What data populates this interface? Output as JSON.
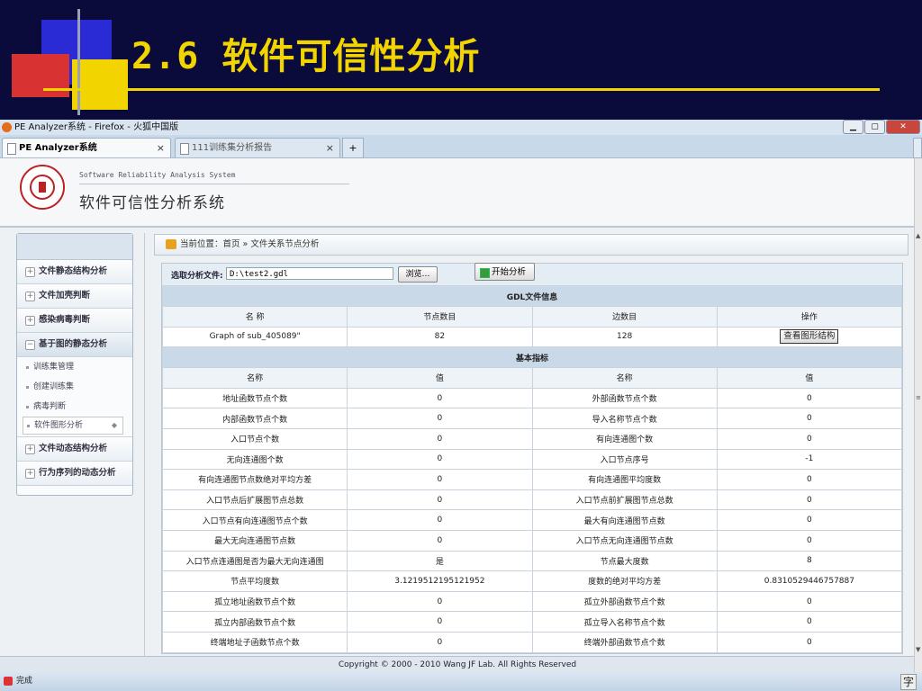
{
  "slide": {
    "title": "2.6 软件可信性分析"
  },
  "browser": {
    "window_title": "PE Analyzer系统 - Firefox - 火狐中国版",
    "tabs": [
      {
        "label": "PE Analyzer系统",
        "active": true
      },
      {
        "label": "111训练集分析报告",
        "active": false
      }
    ],
    "status": "完成",
    "ime": "字"
  },
  "site": {
    "subtitle": "Software Reliability Analysis System",
    "title": "软件可信性分析系统"
  },
  "sidebar": {
    "items": [
      {
        "label": "文件静态结构分析",
        "toggle": "+"
      },
      {
        "label": "文件加壳判断",
        "toggle": "+"
      },
      {
        "label": "感染病毒判断",
        "toggle": "+"
      },
      {
        "label": "基于图的静态分析",
        "toggle": "−"
      }
    ],
    "sub_items": [
      "训练集管理",
      "创建训练集",
      "病毒判断",
      "软件图形分析"
    ],
    "items_after": [
      {
        "label": "文件动态结构分析",
        "toggle": "+"
      },
      {
        "label": "行为序列的动态分析",
        "toggle": "+"
      }
    ]
  },
  "breadcrumb": "当前位置：首页 » 文件关系节点分析",
  "file_select": {
    "label": "选取分析文件:",
    "value": "D:\\test2.gdl",
    "browse_label": "浏览…",
    "start_label": "开始分析"
  },
  "gdl": {
    "section_title": "GDL文件信息",
    "headers": [
      "名 称",
      "节点数目",
      "边数目",
      "操作"
    ],
    "row": {
      "name": "Graph of sub_405089\"",
      "nodes": "82",
      "edges": "128",
      "action": "查看图形结构"
    }
  },
  "metrics": {
    "section_title": "基本指标",
    "headers": [
      "名称",
      "值",
      "名称",
      "值"
    ],
    "rows": [
      [
        "地址函数节点个数",
        "0",
        "外部函数节点个数",
        "0"
      ],
      [
        "内部函数节点个数",
        "0",
        "导入名称节点个数",
        "0"
      ],
      [
        "入口节点个数",
        "0",
        "有向连通图个数",
        "0"
      ],
      [
        "无向连通图个数",
        "0",
        "入口节点序号",
        "-1"
      ],
      [
        "有向连通图节点数绝对平均方差",
        "0",
        "有向连通图平均度数",
        "0"
      ],
      [
        "入口节点后扩展图节点总数",
        "0",
        "入口节点前扩展图节点总数",
        "0"
      ],
      [
        "入口节点有向连通图节点个数",
        "0",
        "最大有向连通图节点数",
        "0"
      ],
      [
        "最大无向连通图节点数",
        "0",
        "入口节点无向连通图节点数",
        "0"
      ],
      [
        "入口节点连通图是否为最大无向连通图",
        "是",
        "节点最大度数",
        "8"
      ],
      [
        "节点平均度数",
        "3.1219512195121952",
        "度数的绝对平均方差",
        "0.8310529446757887"
      ],
      [
        "孤立地址函数节点个数",
        "0",
        "孤立外部函数节点个数",
        "0"
      ],
      [
        "孤立内部函数节点个数",
        "0",
        "孤立导入名称节点个数",
        "0"
      ],
      [
        "终端地址子函数节点个数",
        "0",
        "终端外部函数节点个数",
        "0"
      ]
    ]
  },
  "footer": "Copyright © 2000 - 2010 Wang JF Lab. All Rights Reserved"
}
